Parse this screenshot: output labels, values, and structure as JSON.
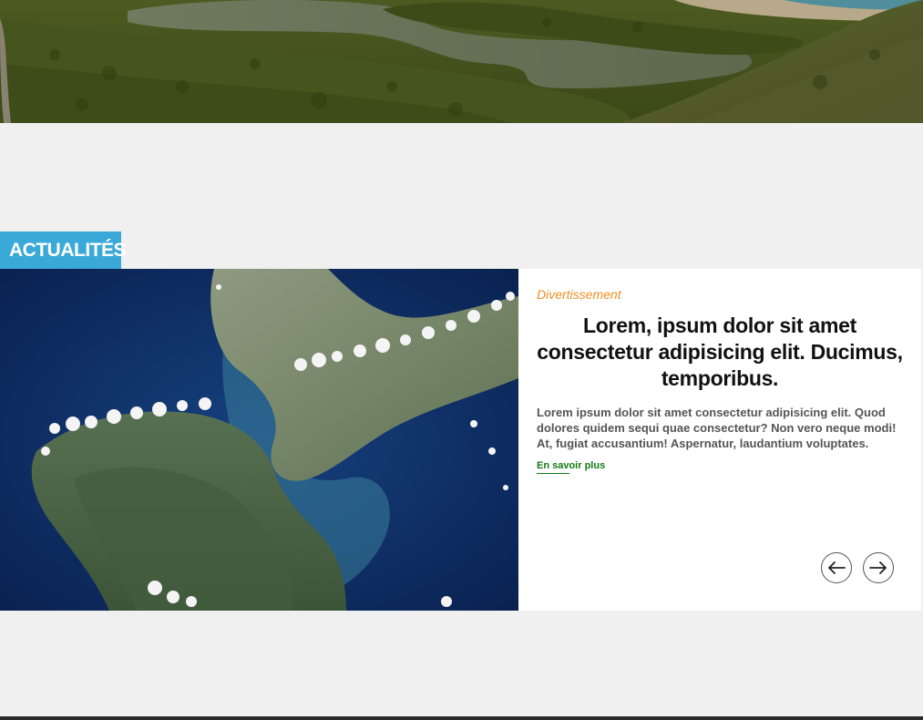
{
  "hero": {
    "image": "aerial-coastal-lagoon-photo"
  },
  "section": {
    "label": "ACTUALITÉS"
  },
  "news": {
    "image": "satellite-island-photo",
    "category": "Divertissement",
    "title": "Lorem, ipsum dolor sit amet consectetur adipisicing elit. Ducimus, temporibus.",
    "text": "Lorem ipsum dolor sit amet consectetur adipisicing elit. Quod dolores quidem sequi quae consectetur? Non vero neque modi! At, fugiat accusantium! Aspernatur, laudantium voluptates.",
    "link_label": "En savoir plus"
  },
  "nav": {
    "prev_icon": "arrow-left-icon",
    "next_icon": "arrow-right-icon"
  },
  "colors": {
    "label_bg": "#3aa9d8",
    "category": "#ef8f21",
    "link": "#127a12",
    "page_bg": "#f0f0f0"
  }
}
